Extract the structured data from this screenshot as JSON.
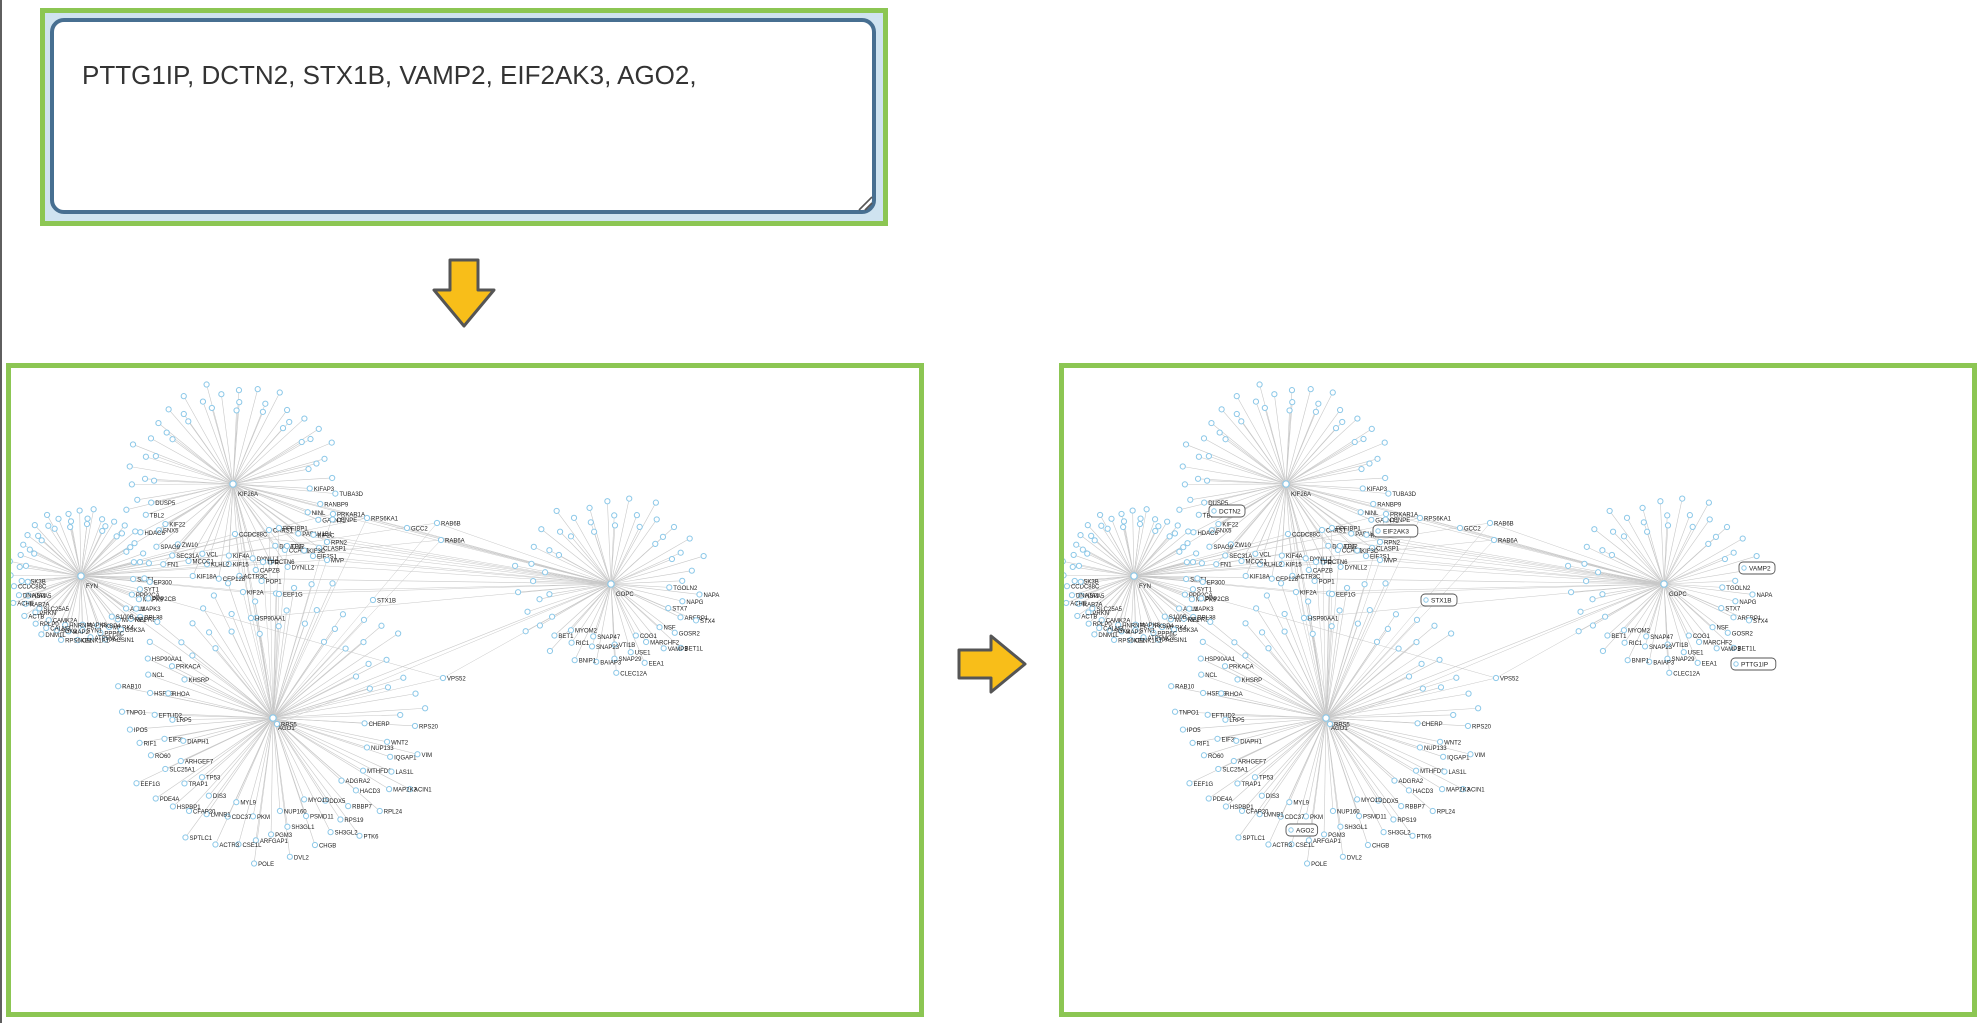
{
  "input": {
    "value": "PTTG1IP, DCTN2, STX1B, VAMP2, EIF2AK3, AGO2,"
  },
  "network": {
    "colors": {
      "node_stroke": "#8cc8e8",
      "edge": "#c8c8c8",
      "label": "#222222",
      "highlight_stroke": "#555555"
    },
    "highlighted": [
      "DCTN2",
      "EIF2AK3",
      "STX1B",
      "VAMP2",
      "PTTG1IP",
      "AGO2"
    ],
    "hubs": [
      {
        "name": "KIF26A",
        "labels": [
          "KIFAP3",
          "RANBP9",
          "TUBA3D",
          "NINL",
          "GALNT1",
          "CENPE",
          "PAFAH1B1",
          "KIF2C",
          "CLASP1",
          "CCAR1",
          "KIF3C",
          "DYNC1I2",
          "DCTN6",
          "DYNLL2",
          "DYNLL1",
          "CAPZB",
          "POP1",
          "KIF15",
          "ACTR3C",
          "KIF4A",
          "KLHL2",
          "CEP128",
          "VCL",
          "MCCC1",
          "KIF18A",
          "ZW10",
          "SEC31A",
          "FN1",
          "SNX5",
          "SPAG9",
          "KIF22",
          "TBL2",
          "HDAC6",
          "DUSP5"
        ]
      },
      {
        "name": "FYN",
        "labels": [
          "SIRT1",
          "SYT1",
          "EP300",
          "PPP2CA",
          "MAPK9",
          "PPP2CB",
          "ABL1",
          "MAPK3",
          "RPL28",
          "MAPRE1",
          "MAPRE3",
          "S100B",
          "MARK4",
          "GSK3A",
          "FKBP4",
          "PPP6C",
          "PACSIN1",
          "SYN1",
          "ATP5MC2",
          "MAPK8",
          "MAP2",
          "CSNK1A1",
          "HNRNPL",
          "SGK1",
          "RPS6KB1",
          "CAMK2A",
          "CALM3",
          "DNM1L",
          "PRKN",
          "RPLP0",
          "SLC25A5",
          "RAB7A",
          "ACTB",
          "HSPA5",
          "DNAJA1",
          "ACHE",
          "GSK3B",
          "CCDC88C"
        ]
      },
      {
        "name": "AGO1",
        "labels": [
          "CHERP",
          "WNT2",
          "RPS20",
          "NUP133",
          "IQGAP1",
          "VIM",
          "MTHFD2",
          "LAS1L",
          "ACIN1",
          "HACD3",
          "MAP2K3",
          "ADGRA2",
          "RBBP7",
          "RPL24",
          "DDX5",
          "RPS19",
          "PTK6",
          "PSMD11",
          "SH3GL2",
          "MYO1D",
          "SH3GL1",
          "CHGB",
          "NUP160",
          "PGM3",
          "DVL2",
          "PKM",
          "ARFGAP1",
          "POLE",
          "CDC37",
          "CSE1L",
          "MYL9",
          "LMNB1",
          "ACTR3",
          "DIS3",
          "CFAP20",
          "SPTLC1",
          "TRAP1",
          "HSPBP1",
          "TP53",
          "SLC25A1",
          "PDE4A",
          "ARHGEF7",
          "RO60",
          "EEF1G",
          "EIF3L",
          "RIF1",
          "DIAPH1",
          "EFTUD2",
          "IPO5",
          "LRP5",
          "HSPA9",
          "TNPO1",
          "RHOA",
          "NCL",
          "RAB10",
          "PRKACA",
          "HSP90AA1",
          "KHSRP"
        ]
      },
      {
        "name": "GOPC",
        "labels": [
          "TGOLN2",
          "NAPG",
          "NAPA",
          "STX7",
          "ARFRP1",
          "STX4",
          "NSF",
          "GOSR2",
          "BET1L",
          "MARCHF2",
          "VAMP3",
          "COG1",
          "USE1",
          "EEA1",
          "VTI1B",
          "SNAP29",
          "CLEC12A",
          "SNAP23",
          "BAIAP3",
          "SNAP47",
          "RIC1",
          "BNIP1",
          "MYOM2",
          "BET1"
        ]
      }
    ],
    "bridges": [
      "PRKAR1A",
      "RPS6KA1",
      "GCC2",
      "RAB6B",
      "RAB6A",
      "CARS1",
      "PPFIBP1",
      "TFG",
      "RPN2",
      "EIF2S1",
      "MVP",
      "TPR",
      "EEF1G",
      "KIF2A",
      "HSP90AA1",
      "VPS52",
      "RPS5",
      "CCDC88C"
    ]
  }
}
